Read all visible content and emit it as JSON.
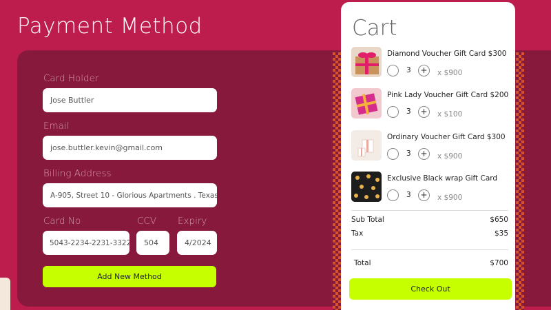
{
  "page_title": "Payment Method",
  "form": {
    "card_holder_label": "Card Holder",
    "card_holder_value": "Jose Buttler",
    "email_label": "Email",
    "email_value": "jose.buttler.kevin@gmail.com",
    "billing_label": "Billing Address",
    "billing_value": "A-905, Street 10 - Glorious Apartments . Texas",
    "card_no_label": "Card No",
    "card_no_value": "5043-2234-2231-3322",
    "ccv_label": "CCV",
    "ccv_value": "504",
    "expiry_label": "Expiry",
    "expiry_value": "4/2024",
    "add_button": "Add New Method"
  },
  "cart": {
    "title": "Cart",
    "items": [
      {
        "name": "Diamond Voucher Gift Card $300",
        "qty": "3",
        "price": "x $900",
        "thumb_icon": "gift-box-pink-ribbon-icon"
      },
      {
        "name": "Pink Lady Voucher Gift Card $200",
        "qty": "3",
        "price": "x $100",
        "thumb_icon": "gift-box-pink-icon"
      },
      {
        "name": "Ordinary Voucher Gift Card $300",
        "qty": "3",
        "price": "x $900",
        "thumb_icon": "gift-box-white-icon"
      },
      {
        "name": "Exclusive Black wrap Gift Card",
        "qty": "3",
        "price": "x $900",
        "thumb_icon": "gift-box-black-icon"
      }
    ],
    "qty_plus_symbol": "+",
    "subtotal_label": "Sub Total",
    "subtotal_value": "$650",
    "tax_label": "Tax",
    "tax_value": "$35",
    "total_label": "Total",
    "total_value": "$700",
    "checkout_button": "Check Out"
  },
  "colors": {
    "background": "#bd1d4d",
    "panel": "#871a3c",
    "accent": "#c5ff00",
    "checker": "#d8552a"
  }
}
